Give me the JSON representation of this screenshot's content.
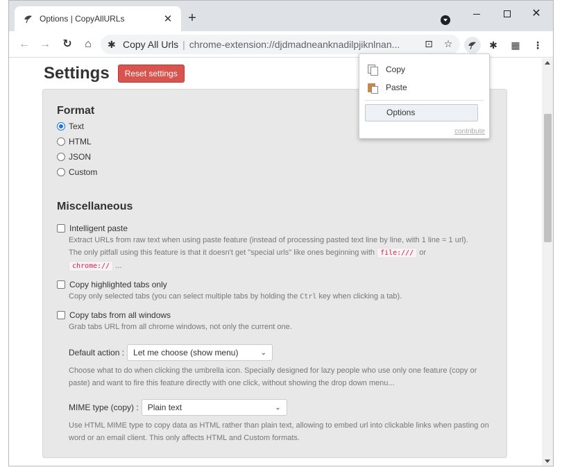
{
  "browser": {
    "tab_title": "Options | CopyAllURLs",
    "tab_close": "✕",
    "new_tab": "+",
    "address": {
      "site_name": "Copy All Urls",
      "separator": "|",
      "url": "chrome-extension://djdmadneanknadilpjiknlnan..."
    }
  },
  "header": {
    "title": "Settings",
    "reset_label": "Reset settings"
  },
  "format": {
    "title": "Format",
    "options": [
      "Text",
      "HTML",
      "JSON",
      "Custom"
    ],
    "selected": "Text"
  },
  "misc": {
    "title": "Miscellaneous",
    "intelligent_paste": {
      "label": "Intelligent paste",
      "help_1": "Extract URLs from raw text when using paste feature (instead of processing pasted text line by line, with 1 line = 1 url).",
      "help_2": "The only pitfall using this feature is that it doesn't get \"special urls\" like ones beginning with",
      "code_1": "file:///",
      "or": "or",
      "code_2": "chrome://",
      "ellipsis": "..."
    },
    "highlighted_tabs": {
      "label": "Copy highlighted tabs only",
      "help_pre": "Copy only selected tabs (you can select multiple tabs by holding the",
      "kbd": "Ctrl",
      "help_post": "key when clicking a tab)."
    },
    "all_windows": {
      "label": "Copy tabs from all windows",
      "help": "Grab tabs URL from all chrome windows, not only the current one."
    },
    "default_action": {
      "label": "Default action :",
      "value": "Let me choose (show menu)",
      "help": "Choose what to do when clicking the umbrella icon. Specially designed for lazy people who use only one feature (copy or paste) and want to fire this feature directly with one click, without showing the drop down menu..."
    },
    "mime_type": {
      "label": "MIME type (copy) :",
      "value": "Plain text",
      "help": "Use HTML MIME type to copy data as HTML rather than plain text, allowing to embed url into clickable links when pasting on word or an email client. This only affects HTML and Custom formats."
    }
  },
  "popup": {
    "copy": "Copy",
    "paste": "Paste",
    "options": "Options",
    "contribute": "contribute"
  }
}
